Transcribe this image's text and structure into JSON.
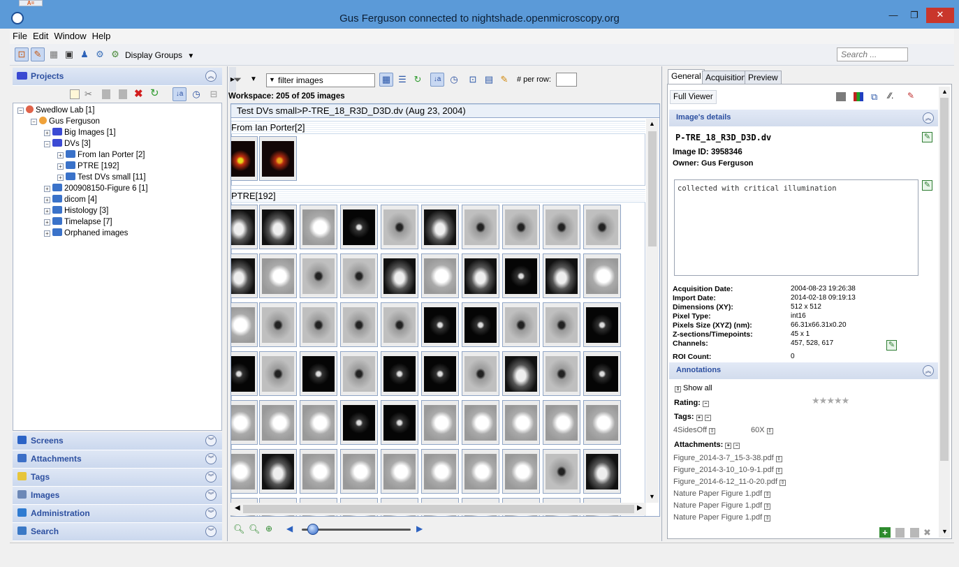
{
  "window": {
    "title": "Gus Ferguson connected to nightshade.openmicroscopy.org",
    "min": "—",
    "max": "❐",
    "close": "✕"
  },
  "menu": [
    "File",
    "Edit",
    "Window",
    "Help"
  ],
  "toolbar": {
    "display_groups": "Display Groups",
    "search_placeholder": "Search ..."
  },
  "left": {
    "projects_label": "Projects",
    "tree": [
      {
        "label": "Swedlow Lab [1]",
        "level": 0,
        "kind": "group",
        "toggle": "−"
      },
      {
        "label": "Gus Ferguson",
        "level": 1,
        "kind": "user",
        "toggle": "−"
      },
      {
        "label": "Big Images [1]",
        "level": 2,
        "kind": "project",
        "toggle": "+"
      },
      {
        "label": "DVs [3]",
        "level": 2,
        "kind": "project",
        "toggle": "−"
      },
      {
        "label": "From Ian Porter [2]",
        "level": 3,
        "kind": "dataset",
        "toggle": "+"
      },
      {
        "label": "PTRE [192]",
        "level": 3,
        "kind": "dataset",
        "toggle": "+"
      },
      {
        "label": "Test DVs small [11]",
        "level": 3,
        "kind": "dataset",
        "toggle": "+"
      },
      {
        "label": "200908150-Figure 6 [1]",
        "level": 2,
        "kind": "dataset",
        "toggle": "+"
      },
      {
        "label": "dicom [4]",
        "level": 2,
        "kind": "dataset",
        "toggle": "+"
      },
      {
        "label": "Histology [3]",
        "level": 2,
        "kind": "dataset",
        "toggle": "+"
      },
      {
        "label": "Timelapse [7]",
        "level": 2,
        "kind": "dataset",
        "toggle": "+"
      },
      {
        "label": "Orphaned images",
        "level": 2,
        "kind": "dataset",
        "toggle": "+"
      }
    ],
    "sections": [
      {
        "label": "Screens",
        "icon": "screens-icon",
        "color": "#2b63c6"
      },
      {
        "label": "Attachments",
        "icon": "attachments-icon",
        "color": "#3c6fc7"
      },
      {
        "label": "Tags",
        "icon": "tags-icon",
        "color": "#e7c53a"
      },
      {
        "label": "Images",
        "icon": "images-icon",
        "color": "#6c88b7"
      },
      {
        "label": "Administration",
        "icon": "administration-icon",
        "color": "#2f7bd1"
      },
      {
        "label": "Search",
        "icon": "search-icon",
        "color": "#3b79c6"
      }
    ]
  },
  "center": {
    "filter_value": "filter  images",
    "per_row_label": "# per row:",
    "workspace": "Workspace: 205 of 205 images",
    "breadcrumb": "Test DVs small>P-TRE_18_R3D_D3D.dv (Aug 23, 2004)",
    "groups": [
      {
        "label": "From Ian Porter[2]"
      },
      {
        "label": "PTRE[192]"
      }
    ],
    "zoom_slider_value": 0.1
  },
  "right": {
    "tabs": [
      "General",
      "Acquisition",
      "Preview"
    ],
    "full_viewer": "Full Viewer",
    "image_details_label": "Image's details",
    "image_name": "P-TRE_18_R3D_D3D.dv",
    "image_id": "Image ID: 3958346",
    "owner": "Owner: Gus Ferguson",
    "description": "collected with critical illumination",
    "fields": [
      {
        "k": "Acquisition Date:",
        "v": "2004-08-23 19:26:38"
      },
      {
        "k": "Import Date:",
        "v": "2014-02-18 09:19:13"
      },
      {
        "k": "Dimensions (XY):",
        "v": "512 x 512"
      },
      {
        "k": "Pixel Type:",
        "v": "int16"
      },
      {
        "k": "Pixels Size (XYZ) (nm):",
        "v": "66.31x66.31x0.20"
      },
      {
        "k": "Z-sections/Timepoints:",
        "v": "45 x 1"
      },
      {
        "k": "Channels:",
        "v": "457, 528, 617"
      },
      {
        "k": "ROI Count:",
        "v": "0"
      }
    ],
    "annotations_label": "Annotations",
    "show_all": "Show all",
    "rating_label": "Rating:",
    "rating_value": 0,
    "tags_label": "Tags:",
    "tags": [
      "4SidesOff",
      "60X"
    ],
    "attachments_label": "Attachments:",
    "attachments": [
      "Figure_2014-3-7_15-3-38.pdf",
      "Figure_2014-3-10_10-9-1.pdf",
      "Figure_2014-6-12_11-0-20.pdf",
      "Nature Paper Figure 1.pdf",
      "Nature Paper Figure 1.pdf",
      "Nature Paper Figure 1.pdf"
    ]
  }
}
